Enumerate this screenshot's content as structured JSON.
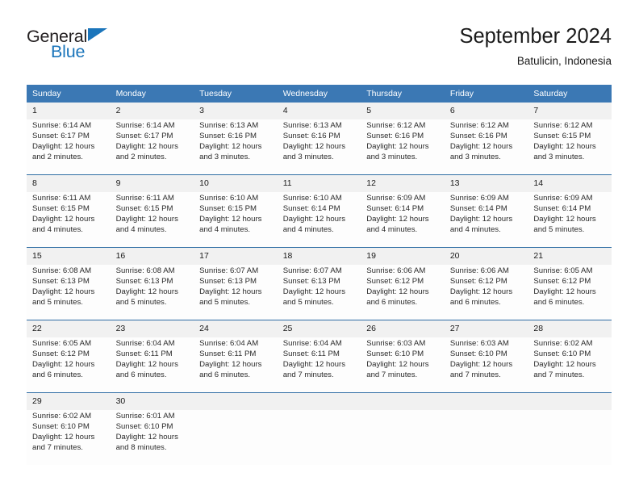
{
  "brand": {
    "name_part1": "General",
    "name_part2": "Blue",
    "triangle_color": "#1b75bb"
  },
  "header": {
    "title": "September 2024",
    "subtitle": "Batulicin, Indonesia"
  },
  "theme": {
    "header_blue": "#3b78b4",
    "separator_blue": "#2e6da4",
    "daynum_gray": "#f1f1f1",
    "cell_white": "#fdfdfd"
  },
  "calendar": {
    "weekday_headers": [
      "Sunday",
      "Monday",
      "Tuesday",
      "Wednesday",
      "Thursday",
      "Friday",
      "Saturday"
    ],
    "weeks": [
      {
        "days": [
          {
            "date": "1",
            "sunrise": "Sunrise: 6:14 AM",
            "sunset": "Sunset: 6:17 PM",
            "daylight_line1": "Daylight: 12 hours",
            "daylight_line2": "and 2 minutes."
          },
          {
            "date": "2",
            "sunrise": "Sunrise: 6:14 AM",
            "sunset": "Sunset: 6:17 PM",
            "daylight_line1": "Daylight: 12 hours",
            "daylight_line2": "and 2 minutes."
          },
          {
            "date": "3",
            "sunrise": "Sunrise: 6:13 AM",
            "sunset": "Sunset: 6:16 PM",
            "daylight_line1": "Daylight: 12 hours",
            "daylight_line2": "and 3 minutes."
          },
          {
            "date": "4",
            "sunrise": "Sunrise: 6:13 AM",
            "sunset": "Sunset: 6:16 PM",
            "daylight_line1": "Daylight: 12 hours",
            "daylight_line2": "and 3 minutes."
          },
          {
            "date": "5",
            "sunrise": "Sunrise: 6:12 AM",
            "sunset": "Sunset: 6:16 PM",
            "daylight_line1": "Daylight: 12 hours",
            "daylight_line2": "and 3 minutes."
          },
          {
            "date": "6",
            "sunrise": "Sunrise: 6:12 AM",
            "sunset": "Sunset: 6:16 PM",
            "daylight_line1": "Daylight: 12 hours",
            "daylight_line2": "and 3 minutes."
          },
          {
            "date": "7",
            "sunrise": "Sunrise: 6:12 AM",
            "sunset": "Sunset: 6:15 PM",
            "daylight_line1": "Daylight: 12 hours",
            "daylight_line2": "and 3 minutes."
          }
        ]
      },
      {
        "days": [
          {
            "date": "8",
            "sunrise": "Sunrise: 6:11 AM",
            "sunset": "Sunset: 6:15 PM",
            "daylight_line1": "Daylight: 12 hours",
            "daylight_line2": "and 4 minutes."
          },
          {
            "date": "9",
            "sunrise": "Sunrise: 6:11 AM",
            "sunset": "Sunset: 6:15 PM",
            "daylight_line1": "Daylight: 12 hours",
            "daylight_line2": "and 4 minutes."
          },
          {
            "date": "10",
            "sunrise": "Sunrise: 6:10 AM",
            "sunset": "Sunset: 6:15 PM",
            "daylight_line1": "Daylight: 12 hours",
            "daylight_line2": "and 4 minutes."
          },
          {
            "date": "11",
            "sunrise": "Sunrise: 6:10 AM",
            "sunset": "Sunset: 6:14 PM",
            "daylight_line1": "Daylight: 12 hours",
            "daylight_line2": "and 4 minutes."
          },
          {
            "date": "12",
            "sunrise": "Sunrise: 6:09 AM",
            "sunset": "Sunset: 6:14 PM",
            "daylight_line1": "Daylight: 12 hours",
            "daylight_line2": "and 4 minutes."
          },
          {
            "date": "13",
            "sunrise": "Sunrise: 6:09 AM",
            "sunset": "Sunset: 6:14 PM",
            "daylight_line1": "Daylight: 12 hours",
            "daylight_line2": "and 4 minutes."
          },
          {
            "date": "14",
            "sunrise": "Sunrise: 6:09 AM",
            "sunset": "Sunset: 6:14 PM",
            "daylight_line1": "Daylight: 12 hours",
            "daylight_line2": "and 5 minutes."
          }
        ]
      },
      {
        "days": [
          {
            "date": "15",
            "sunrise": "Sunrise: 6:08 AM",
            "sunset": "Sunset: 6:13 PM",
            "daylight_line1": "Daylight: 12 hours",
            "daylight_line2": "and 5 minutes."
          },
          {
            "date": "16",
            "sunrise": "Sunrise: 6:08 AM",
            "sunset": "Sunset: 6:13 PM",
            "daylight_line1": "Daylight: 12 hours",
            "daylight_line2": "and 5 minutes."
          },
          {
            "date": "17",
            "sunrise": "Sunrise: 6:07 AM",
            "sunset": "Sunset: 6:13 PM",
            "daylight_line1": "Daylight: 12 hours",
            "daylight_line2": "and 5 minutes."
          },
          {
            "date": "18",
            "sunrise": "Sunrise: 6:07 AM",
            "sunset": "Sunset: 6:13 PM",
            "daylight_line1": "Daylight: 12 hours",
            "daylight_line2": "and 5 minutes."
          },
          {
            "date": "19",
            "sunrise": "Sunrise: 6:06 AM",
            "sunset": "Sunset: 6:12 PM",
            "daylight_line1": "Daylight: 12 hours",
            "daylight_line2": "and 6 minutes."
          },
          {
            "date": "20",
            "sunrise": "Sunrise: 6:06 AM",
            "sunset": "Sunset: 6:12 PM",
            "daylight_line1": "Daylight: 12 hours",
            "daylight_line2": "and 6 minutes."
          },
          {
            "date": "21",
            "sunrise": "Sunrise: 6:05 AM",
            "sunset": "Sunset: 6:12 PM",
            "daylight_line1": "Daylight: 12 hours",
            "daylight_line2": "and 6 minutes."
          }
        ]
      },
      {
        "days": [
          {
            "date": "22",
            "sunrise": "Sunrise: 6:05 AM",
            "sunset": "Sunset: 6:12 PM",
            "daylight_line1": "Daylight: 12 hours",
            "daylight_line2": "and 6 minutes."
          },
          {
            "date": "23",
            "sunrise": "Sunrise: 6:04 AM",
            "sunset": "Sunset: 6:11 PM",
            "daylight_line1": "Daylight: 12 hours",
            "daylight_line2": "and 6 minutes."
          },
          {
            "date": "24",
            "sunrise": "Sunrise: 6:04 AM",
            "sunset": "Sunset: 6:11 PM",
            "daylight_line1": "Daylight: 12 hours",
            "daylight_line2": "and 6 minutes."
          },
          {
            "date": "25",
            "sunrise": "Sunrise: 6:04 AM",
            "sunset": "Sunset: 6:11 PM",
            "daylight_line1": "Daylight: 12 hours",
            "daylight_line2": "and 7 minutes."
          },
          {
            "date": "26",
            "sunrise": "Sunrise: 6:03 AM",
            "sunset": "Sunset: 6:10 PM",
            "daylight_line1": "Daylight: 12 hours",
            "daylight_line2": "and 7 minutes."
          },
          {
            "date": "27",
            "sunrise": "Sunrise: 6:03 AM",
            "sunset": "Sunset: 6:10 PM",
            "daylight_line1": "Daylight: 12 hours",
            "daylight_line2": "and 7 minutes."
          },
          {
            "date": "28",
            "sunrise": "Sunrise: 6:02 AM",
            "sunset": "Sunset: 6:10 PM",
            "daylight_line1": "Daylight: 12 hours",
            "daylight_line2": "and 7 minutes."
          }
        ]
      },
      {
        "days": [
          {
            "date": "29",
            "sunrise": "Sunrise: 6:02 AM",
            "sunset": "Sunset: 6:10 PM",
            "daylight_line1": "Daylight: 12 hours",
            "daylight_line2": "and 7 minutes."
          },
          {
            "date": "30",
            "sunrise": "Sunrise: 6:01 AM",
            "sunset": "Sunset: 6:10 PM",
            "daylight_line1": "Daylight: 12 hours",
            "daylight_line2": "and 8 minutes."
          },
          {
            "date": "",
            "sunrise": "",
            "sunset": "",
            "daylight_line1": "",
            "daylight_line2": ""
          },
          {
            "date": "",
            "sunrise": "",
            "sunset": "",
            "daylight_line1": "",
            "daylight_line2": ""
          },
          {
            "date": "",
            "sunrise": "",
            "sunset": "",
            "daylight_line1": "",
            "daylight_line2": ""
          },
          {
            "date": "",
            "sunrise": "",
            "sunset": "",
            "daylight_line1": "",
            "daylight_line2": ""
          },
          {
            "date": "",
            "sunrise": "",
            "sunset": "",
            "daylight_line1": "",
            "daylight_line2": ""
          }
        ]
      }
    ]
  }
}
